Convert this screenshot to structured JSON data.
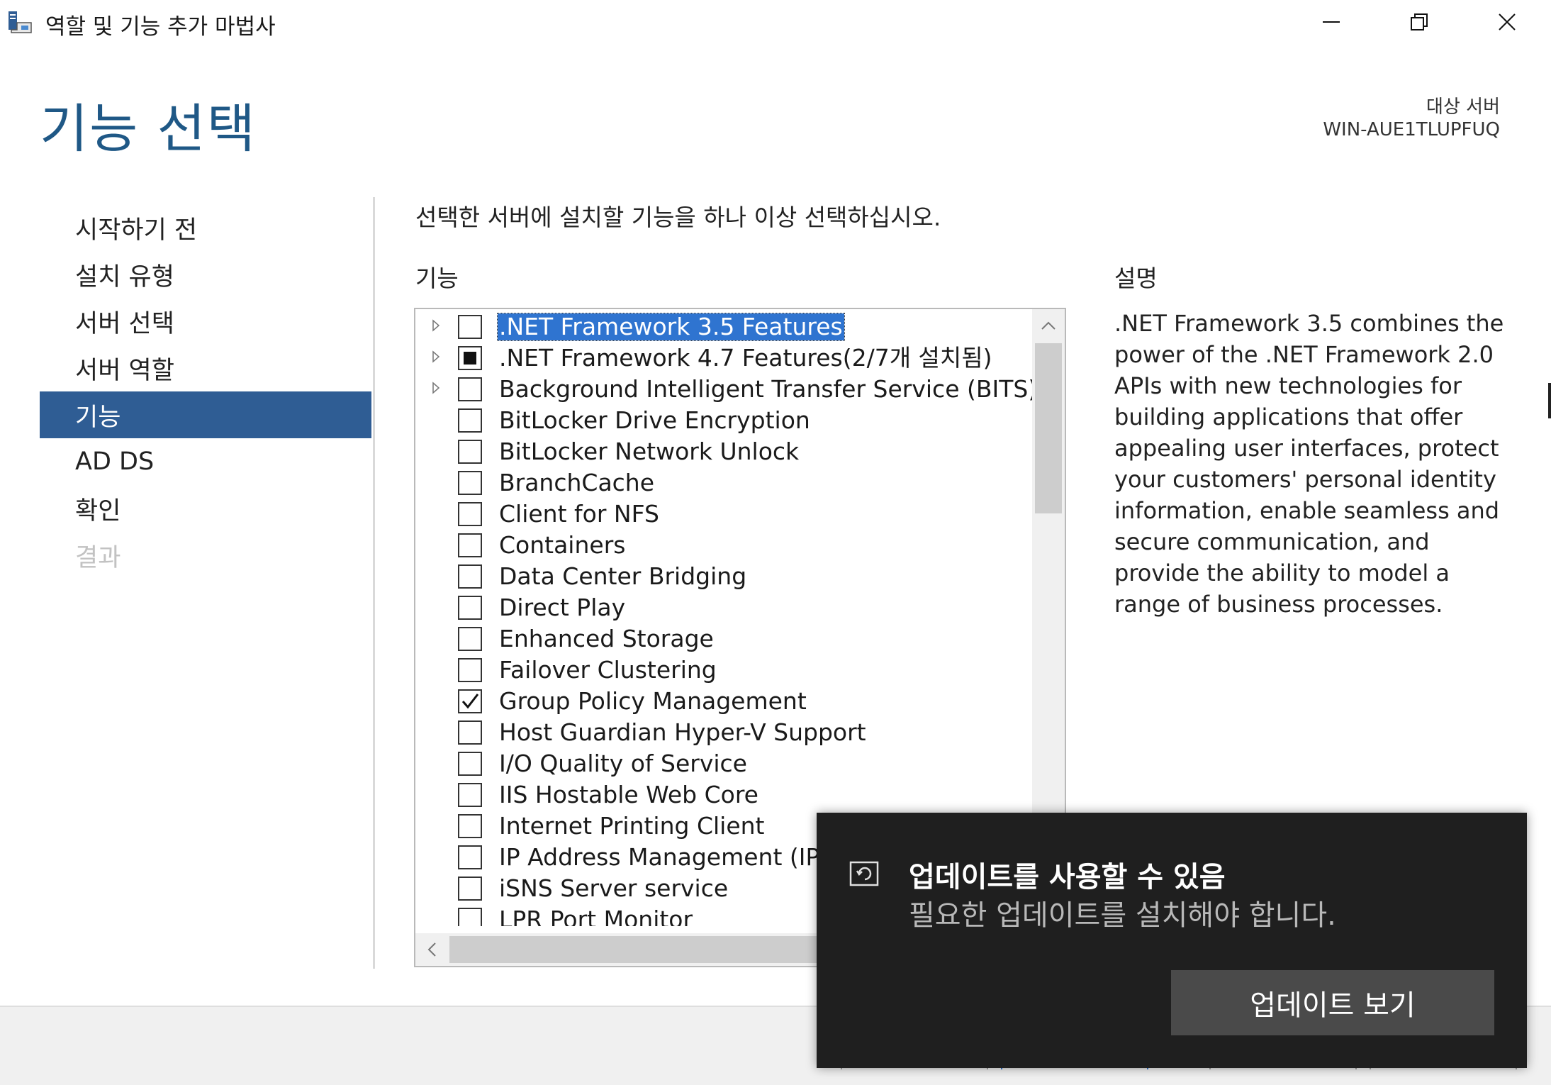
{
  "window": {
    "title": "역할 및 기능 추가 마법사",
    "controls": {
      "minimize": "minimize-icon",
      "maximize": "restore-icon",
      "close": "close-icon"
    }
  },
  "header": {
    "page_title": "기능 선택",
    "destination_label": "대상 서버",
    "destination_server": "WIN-AUE1TLUPFUQ"
  },
  "nav": {
    "items": [
      {
        "label": "시작하기 전",
        "state": "normal"
      },
      {
        "label": "설치 유형",
        "state": "normal"
      },
      {
        "label": "서버 선택",
        "state": "normal"
      },
      {
        "label": "서버 역할",
        "state": "normal"
      },
      {
        "label": "기능",
        "state": "active"
      },
      {
        "label": "AD DS",
        "state": "normal"
      },
      {
        "label": "확인",
        "state": "normal"
      },
      {
        "label": "결과",
        "state": "disabled"
      }
    ]
  },
  "content": {
    "instruction": "선택한 서버에 설치할 기능을 하나 이상 선택하십시오.",
    "features_heading": "기능",
    "description_heading": "설명",
    "description_text": ".NET Framework 3.5 combines the power of the .NET Framework 2.0 APIs with new technologies for building applications that offer appealing user interfaces, protect your customers' personal identity information, enable seamless and secure communication, and provide the ability to model a range of business processes."
  },
  "features": [
    {
      "label": ".NET Framework 3.5 Features",
      "expandable": true,
      "state": "unchecked",
      "selected": true
    },
    {
      "label": ".NET Framework 4.7 Features(2/7개 설치됨)",
      "expandable": true,
      "state": "partial",
      "selected": false
    },
    {
      "label": "Background Intelligent Transfer Service (BITS)",
      "expandable": true,
      "state": "unchecked",
      "selected": false
    },
    {
      "label": "BitLocker Drive Encryption",
      "expandable": false,
      "state": "unchecked",
      "selected": false
    },
    {
      "label": "BitLocker Network Unlock",
      "expandable": false,
      "state": "unchecked",
      "selected": false
    },
    {
      "label": "BranchCache",
      "expandable": false,
      "state": "unchecked",
      "selected": false
    },
    {
      "label": "Client for NFS",
      "expandable": false,
      "state": "unchecked",
      "selected": false
    },
    {
      "label": "Containers",
      "expandable": false,
      "state": "unchecked",
      "selected": false
    },
    {
      "label": "Data Center Bridging",
      "expandable": false,
      "state": "unchecked",
      "selected": false
    },
    {
      "label": "Direct Play",
      "expandable": false,
      "state": "unchecked",
      "selected": false
    },
    {
      "label": "Enhanced Storage",
      "expandable": false,
      "state": "unchecked",
      "selected": false
    },
    {
      "label": "Failover Clustering",
      "expandable": false,
      "state": "unchecked",
      "selected": false
    },
    {
      "label": "Group Policy Management",
      "expandable": false,
      "state": "checked",
      "selected": false
    },
    {
      "label": "Host Guardian Hyper-V Support",
      "expandable": false,
      "state": "unchecked",
      "selected": false
    },
    {
      "label": "I/O Quality of Service",
      "expandable": false,
      "state": "unchecked",
      "selected": false
    },
    {
      "label": "IIS Hostable Web Core",
      "expandable": false,
      "state": "unchecked",
      "selected": false
    },
    {
      "label": "Internet Printing Client",
      "expandable": false,
      "state": "unchecked",
      "selected": false
    },
    {
      "label": "IP Address Management (IPAM",
      "expandable": false,
      "state": "unchecked",
      "selected": false
    },
    {
      "label": "iSNS Server service",
      "expandable": false,
      "state": "unchecked",
      "selected": false
    },
    {
      "label": "LPR Port Monitor",
      "expandable": false,
      "state": "unchecked",
      "selected": false
    }
  ],
  "toast": {
    "icon": "update-icon",
    "title": "업데이트를 사용할 수 있음",
    "body": "필요한 업데이트를 설치해야 합니다.",
    "button_label": "업데이트 보기"
  },
  "colors": {
    "accent": "#2f5d94",
    "title_blue": "#1f5886",
    "selection": "#2f74d0",
    "toast_bg": "#1f1f1f"
  }
}
